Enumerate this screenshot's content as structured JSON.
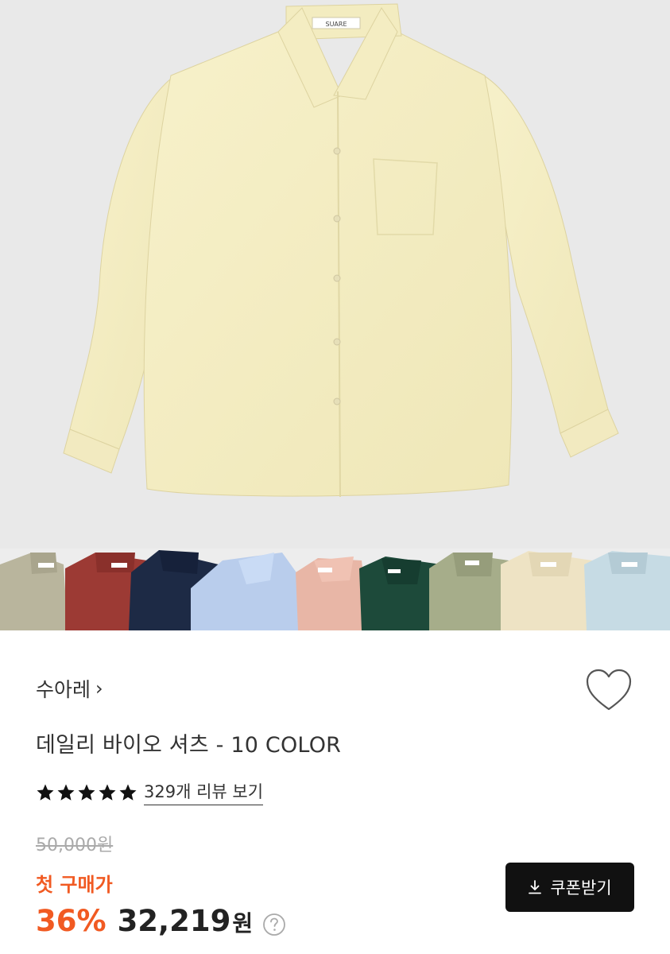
{
  "hero": {
    "collar_label": "SUARE",
    "shirt_color": "#f5efc4",
    "background": "#e9e9e9"
  },
  "color_strip": {
    "swatches": [
      {
        "color": "#b9b59d",
        "label": "SUARE"
      },
      {
        "color": "#9c3a34",
        "label": "SUARE"
      },
      {
        "color": "#1d2a45",
        "label": ""
      },
      {
        "color": "#b9cdec",
        "label": ""
      },
      {
        "color": "#e8b6a6",
        "label": "SUARE"
      },
      {
        "color": "#1d4a3a",
        "label": ""
      },
      {
        "color": "#a6ad8a",
        "label": "SUARE"
      },
      {
        "color": "#eee3c4",
        "label": "SUARE"
      },
      {
        "color": "#c6dbe4",
        "label": "SUARE"
      }
    ]
  },
  "product": {
    "brand": "수아레",
    "brand_chevron": "›",
    "title": "데일리 바이오 셔츠 - 10 COLOR",
    "rating_stars": 5,
    "review_text": "329개 리뷰 보기",
    "original_price": "50,000원",
    "first_purchase_label": "첫 구매가",
    "discount": "36%",
    "price": "32,219",
    "currency": "원"
  },
  "actions": {
    "coupon_label": "쿠폰받기",
    "wishlist_icon": "heart-outline-icon",
    "help_icon": "question-circle-icon",
    "download_icon": "download-icon"
  },
  "colors": {
    "accent": "#f15a22",
    "button_bg": "#111111",
    "star": "#111111"
  }
}
